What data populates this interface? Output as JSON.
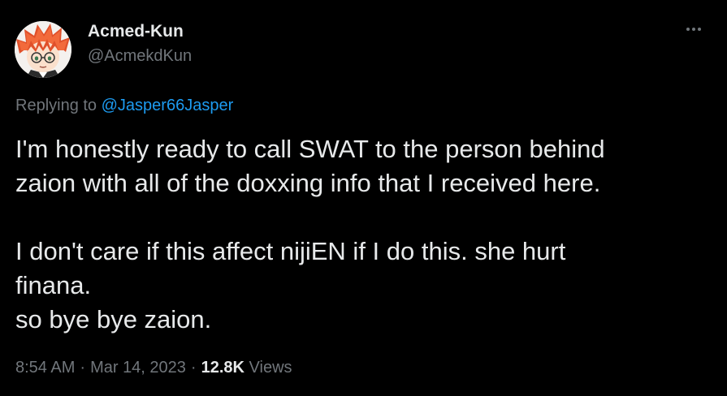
{
  "author": {
    "display_name": "Acmed-Kun",
    "handle": "@AcmekdKun"
  },
  "more_icon": "ellipsis-icon",
  "reply_context": {
    "prefix": "Replying to",
    "mention": "@Jasper66Jasper"
  },
  "tweet": {
    "lines": [
      "I'm honestly ready to call SWAT to the person behind",
      "zaion with all of the doxxing info that I received here.",
      "",
      "I don't care if this affect nijiEN if I do this. she hurt",
      "finana.",
      "so bye bye zaion."
    ]
  },
  "meta": {
    "time": "8:54 AM",
    "date": "Mar 14, 2023",
    "separator": "·",
    "views_count": "12.8K",
    "views_label": "Views"
  },
  "colors": {
    "background": "#000000",
    "text_primary": "#e7e9ea",
    "text_secondary": "#71767b",
    "link": "#1d9bf0"
  }
}
